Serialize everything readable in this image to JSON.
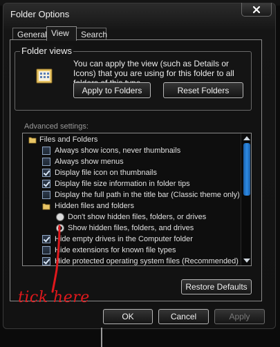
{
  "window": {
    "title": "Folder Options"
  },
  "tabs": [
    {
      "label": "General",
      "active": false
    },
    {
      "label": "View",
      "active": true
    },
    {
      "label": "Search",
      "active": false
    }
  ],
  "folder_views": {
    "title": "Folder views",
    "description": "You can apply the view (such as Details or Icons) that you are using for this folder to all folders of this type.",
    "apply_label": "Apply to Folders",
    "reset_label": "Reset Folders"
  },
  "advanced": {
    "label": "Advanced settings:",
    "items": [
      {
        "type": "folder",
        "label": "Files and Folders",
        "indent": 0
      },
      {
        "type": "checkbox",
        "label": "Always show icons, never thumbnails",
        "checked": false,
        "indent": 1
      },
      {
        "type": "checkbox",
        "label": "Always show menus",
        "checked": false,
        "indent": 1
      },
      {
        "type": "checkbox",
        "label": "Display file icon on thumbnails",
        "checked": true,
        "indent": 1
      },
      {
        "type": "checkbox",
        "label": "Display file size information in folder tips",
        "checked": true,
        "indent": 1
      },
      {
        "type": "checkbox",
        "label": "Display the full path in the title bar (Classic theme only)",
        "checked": false,
        "indent": 1
      },
      {
        "type": "folder",
        "label": "Hidden files and folders",
        "indent": 1
      },
      {
        "type": "radio",
        "label": "Don't show hidden files, folders, or drives",
        "checked": false,
        "indent": 2
      },
      {
        "type": "radio",
        "label": "Show hidden files, folders, and drives",
        "checked": true,
        "indent": 2
      },
      {
        "type": "checkbox",
        "label": "Hide empty drives in the Computer folder",
        "checked": true,
        "indent": 1
      },
      {
        "type": "checkbox",
        "label": "Hide extensions for known file types",
        "checked": false,
        "indent": 1
      },
      {
        "type": "checkbox",
        "label": "Hide protected operating system files (Recommended)",
        "checked": true,
        "indent": 1
      }
    ]
  },
  "buttons": {
    "restore_defaults": "Restore Defaults",
    "ok": "OK",
    "cancel": "Cancel",
    "apply": "Apply"
  },
  "annotation": {
    "text": "tick here",
    "color": "#e0181c"
  },
  "icons": {
    "close": "close-icon",
    "folder_views": "folder-views-icon",
    "folder": "folder-icon",
    "scroll_up": "scroll-up-icon",
    "scroll_down": "scroll-down-icon"
  }
}
